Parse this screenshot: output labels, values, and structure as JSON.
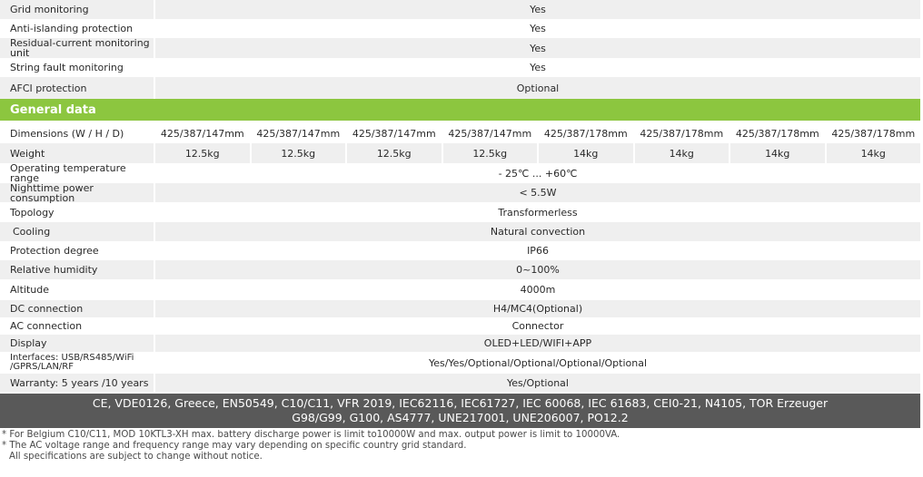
{
  "top_rows": [
    {
      "label": "Grid monitoring",
      "value": "Yes"
    },
    {
      "label": "Anti-islanding protection",
      "value": "Yes"
    },
    {
      "label": "Residual-current monitoring unit",
      "value": "Yes"
    },
    {
      "label": "String fault monitoring",
      "value": "Yes"
    },
    {
      "label": "AFCI protection",
      "value": "Optional"
    }
  ],
  "section_title": "General data",
  "dimensions": {
    "label": "Dimensions (W / H / D)",
    "values": [
      "425/387/147mm",
      "425/387/147mm",
      "425/387/147mm",
      "425/387/147mm",
      "425/387/178mm",
      "425/387/178mm",
      "425/387/178mm",
      "425/387/178mm"
    ]
  },
  "weight": {
    "label": "Weight",
    "values": [
      "12.5kg",
      "12.5kg",
      "12.5kg",
      "12.5kg",
      "14kg",
      "14kg",
      "14kg",
      "14kg"
    ]
  },
  "general_rows": [
    {
      "label": "Operating temperature range",
      "value": "- 25℃ ... +60℃"
    },
    {
      "label": "Nighttime power consumption",
      "value": "< 5.5W"
    },
    {
      "label": "Topology",
      "value": "Transformerless"
    },
    {
      "label": "Cooling",
      "value": "Natural convection"
    },
    {
      "label": "Protection degree",
      "value": "IP66"
    },
    {
      "label": "Relative humidity",
      "value": "0~100%"
    },
    {
      "label": "Altitude",
      "value": "4000m"
    },
    {
      "label": "DC connection",
      "value": "H4/MC4(Optional)"
    },
    {
      "label": "AC connection",
      "value": "Connector"
    },
    {
      "label": "Display",
      "value": "OLED+LED/WIFI+APP"
    },
    {
      "label": "Interfaces: USB/RS485/WiFi /GPRS/LAN/RF",
      "value": "Yes/Yes/Optional/Optional/Optional/Optional"
    },
    {
      "label": "Warranty: 5 years /10 years",
      "value": "Yes/Optional"
    }
  ],
  "certifications": {
    "line1": "CE, VDE0126, Greece, EN50549, C10/C11, VFR 2019, IEC62116, IEC61727, IEC 60068, IEC 61683, CEI0-21, N4105, TOR Erzeuger",
    "line2": "G98/G99, G100, AS4777, UNE217001, UNE206007, PO12.2"
  },
  "notes": [
    "* For Belgium C10/C11, MOD 10KTL3-XH max. battery discharge power is limit to10000W and max. output power is limit to 10000VA.",
    "* The AC voltage range and frequency range may vary depending on specific country grid standard.",
    "  All specifications are subject to change without notice."
  ],
  "colors": {
    "section_green": "#8cc63f",
    "cert_gray": "#595959",
    "row_gray": "#efefef"
  }
}
